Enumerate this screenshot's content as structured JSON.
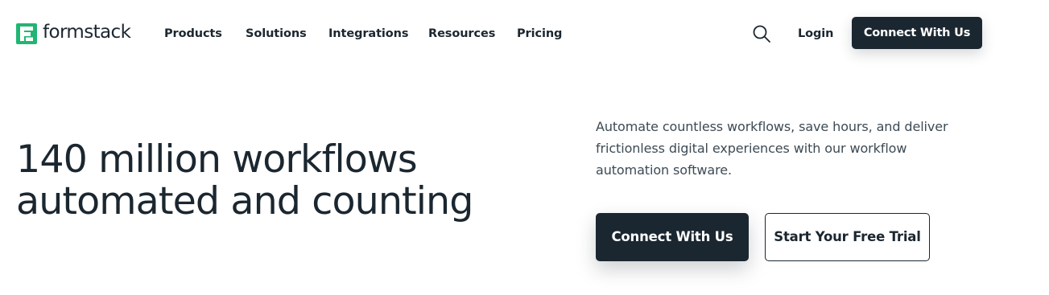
{
  "brand": {
    "name": "formstack",
    "accent_color": "#21b573",
    "dark_color": "#1b2730"
  },
  "nav": {
    "items": [
      {
        "label": "Products"
      },
      {
        "label": "Solutions"
      },
      {
        "label": "Integrations"
      },
      {
        "label": "Resources"
      },
      {
        "label": "Pricing"
      }
    ],
    "search_icon": "search-icon",
    "login_label": "Login",
    "cta_label": "Connect With Us"
  },
  "hero": {
    "title_line1": "140 million workflows",
    "title_line2": "automated and counting",
    "description": "Automate countless workflows, save hours, and deliver frictionless digital experiences with our workflow automation software.",
    "primary_cta": "Connect With Us",
    "secondary_cta": "Start Your Free Trial"
  }
}
